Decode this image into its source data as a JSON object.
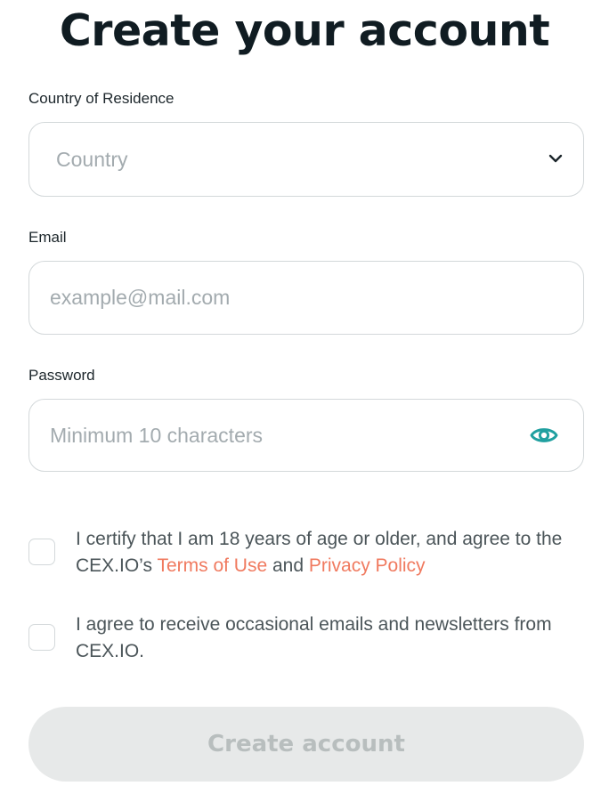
{
  "title": "Create your account",
  "country": {
    "label": "Country of Residence",
    "placeholder": "Country",
    "icon": "chevron-down-icon"
  },
  "email": {
    "label": "Email",
    "placeholder": "example@mail.com",
    "value": ""
  },
  "password": {
    "label": "Password",
    "placeholder": "Minimum 10 characters",
    "value": "",
    "icon": "eye-icon"
  },
  "agreements": {
    "terms": {
      "checked": false,
      "text_before": "I certify that I am 18 years of age or older, and agree to the CEX.IO’s ",
      "terms_link": "Terms of Use",
      "text_middle": " and ",
      "privacy_link": "Privacy Policy"
    },
    "newsletter": {
      "checked": false,
      "text": "I agree to receive occasional emails and newsletters from CEX.IO."
    }
  },
  "submit": {
    "label": "Create account",
    "disabled": true
  },
  "colors": {
    "accent_link": "#f07a5f",
    "eye_icon": "#20a0a0",
    "button_disabled_bg": "#e7e9e9",
    "button_disabled_text": "#b8bebe"
  }
}
